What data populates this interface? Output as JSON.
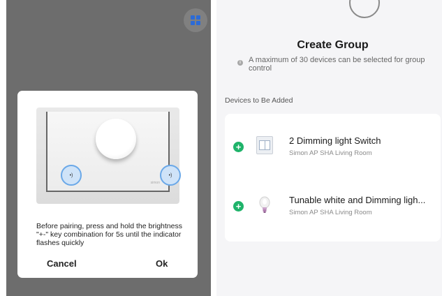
{
  "left_panel": {
    "grid_button_icon": "grid-icon",
    "dialog": {
      "illustration": {
        "left_key_label": "•)",
        "right_key_label": "•)",
        "brand_mark": "simon"
      },
      "message": "Before pairing, press and hold the brightness \"+-\" key combination for 5s until the indicator flashes quickly",
      "cancel_label": "Cancel",
      "ok_label": "Ok"
    }
  },
  "right_panel": {
    "title": "Create Group",
    "info_icon": "info-icon",
    "info_text": "A maximum of 30 devices can be selected for group control",
    "section_label": "Devices to Be Added",
    "devices": [
      {
        "name": "2 Dimming light Switch",
        "room": "Simon AP SHA Living Room",
        "icon": "switch-icon",
        "add_icon": "plus-icon"
      },
      {
        "name": "Tunable white and Dimming ligh...",
        "room": "Simon AP SHA Living Room",
        "icon": "bulb-icon",
        "add_icon": "plus-icon"
      }
    ],
    "colors": {
      "add_green": "#1fb36a",
      "grid_blue": "#2c6bd6"
    }
  }
}
